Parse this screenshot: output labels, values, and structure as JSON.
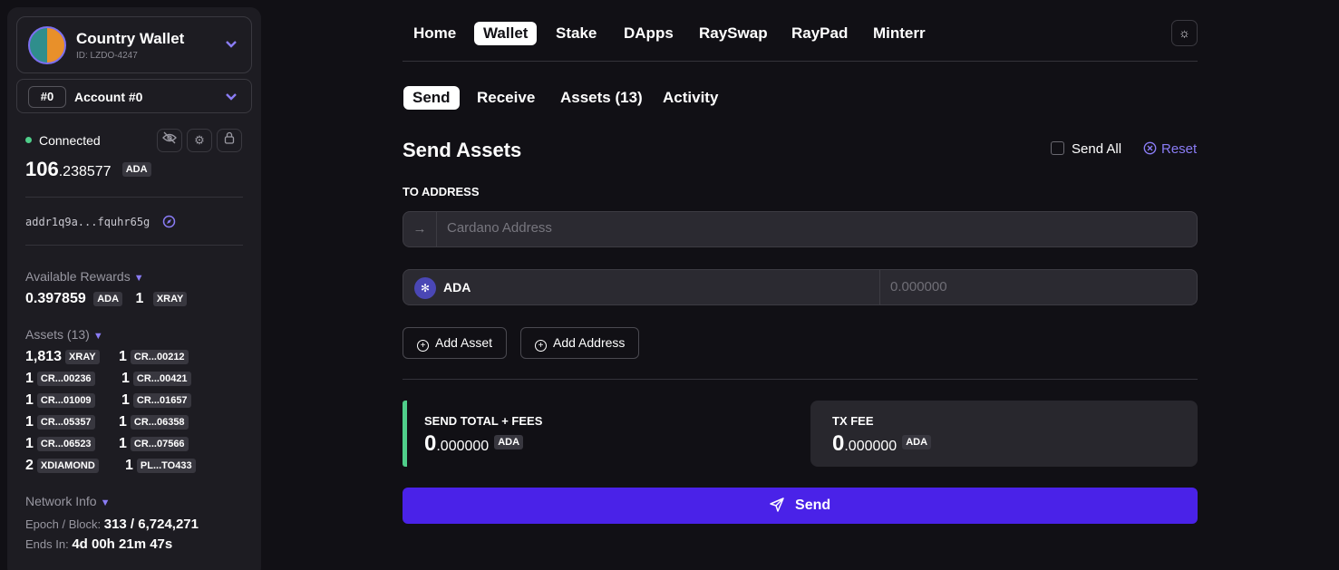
{
  "sidebar": {
    "wallet_name": "Country Wallet",
    "wallet_id": "ID: LZDO-4247",
    "account_badge": "#0",
    "account_name": "Account #0",
    "status": "Connected",
    "balance_int": "106",
    "balance_dec": ".238577",
    "balance_unit": "ADA",
    "address": "addr1q9a...fquhr65g",
    "rewards_label": "Available Rewards",
    "rewards_ada": "0.397859",
    "rewards_ada_unit": "ADA",
    "rewards_xray": "1",
    "rewards_xray_unit": "XRAY",
    "assets_label": "Assets (13)",
    "assets": [
      [
        {
          "qty": "1,813",
          "name": "XRAY"
        },
        {
          "qty": "1",
          "name": "CR...00212"
        }
      ],
      [
        {
          "qty": "1",
          "name": "CR...00236"
        },
        {
          "qty": "1",
          "name": "CR...00421"
        }
      ],
      [
        {
          "qty": "1",
          "name": "CR...01009"
        },
        {
          "qty": "1",
          "name": "CR...01657"
        }
      ],
      [
        {
          "qty": "1",
          "name": "CR...05357"
        },
        {
          "qty": "1",
          "name": "CR...06358"
        }
      ],
      [
        {
          "qty": "1",
          "name": "CR...06523"
        },
        {
          "qty": "1",
          "name": "CR...07566"
        }
      ],
      [
        {
          "qty": "2",
          "name": "XDIAMOND"
        },
        {
          "qty": "1",
          "name": "PL...TO433"
        }
      ]
    ],
    "network_label": "Network Info",
    "epoch_label": "Epoch / Block:",
    "epoch_value": "313 / 6,724,271",
    "ends_label": "Ends In:",
    "ends_value": "4d 00h 21m 47s"
  },
  "nav": [
    "Home",
    "Wallet",
    "Stake",
    "DApps",
    "RaySwap",
    "RayPad",
    "Minterr"
  ],
  "tabs": [
    "Send",
    "Receive",
    "Assets (13)",
    "Activity"
  ],
  "main": {
    "title": "Send Assets",
    "send_all": "Send All",
    "reset": "Reset",
    "to_address_label": "TO ADDRESS",
    "address_placeholder": "Cardano Address",
    "asset_name": "ADA",
    "amount_placeholder": "0.000000",
    "add_asset": "Add Asset",
    "add_address": "Add Address",
    "total_label": "SEND TOTAL + FEES",
    "total_int": "0",
    "total_dec": ".000000",
    "total_unit": "ADA",
    "fee_label": "TX FEE",
    "fee_int": "0",
    "fee_dec": ".000000",
    "fee_unit": "ADA",
    "send_button": "Send"
  },
  "icons": {
    "wallet_chevron": "chevron-down-icon",
    "hide": "eye-off-icon",
    "settings": "gear-icon",
    "lock": "lock-icon",
    "explore": "compass-icon",
    "theme": "sun-icon",
    "arrow": "arrow-right-icon",
    "plus": "plus-circle-icon",
    "reset": "close-circle-icon",
    "send": "paper-plane-icon"
  },
  "colors": {
    "accent": "#8a7cf5",
    "primary_button": "#4a22e8",
    "connected": "#4fce8a"
  }
}
